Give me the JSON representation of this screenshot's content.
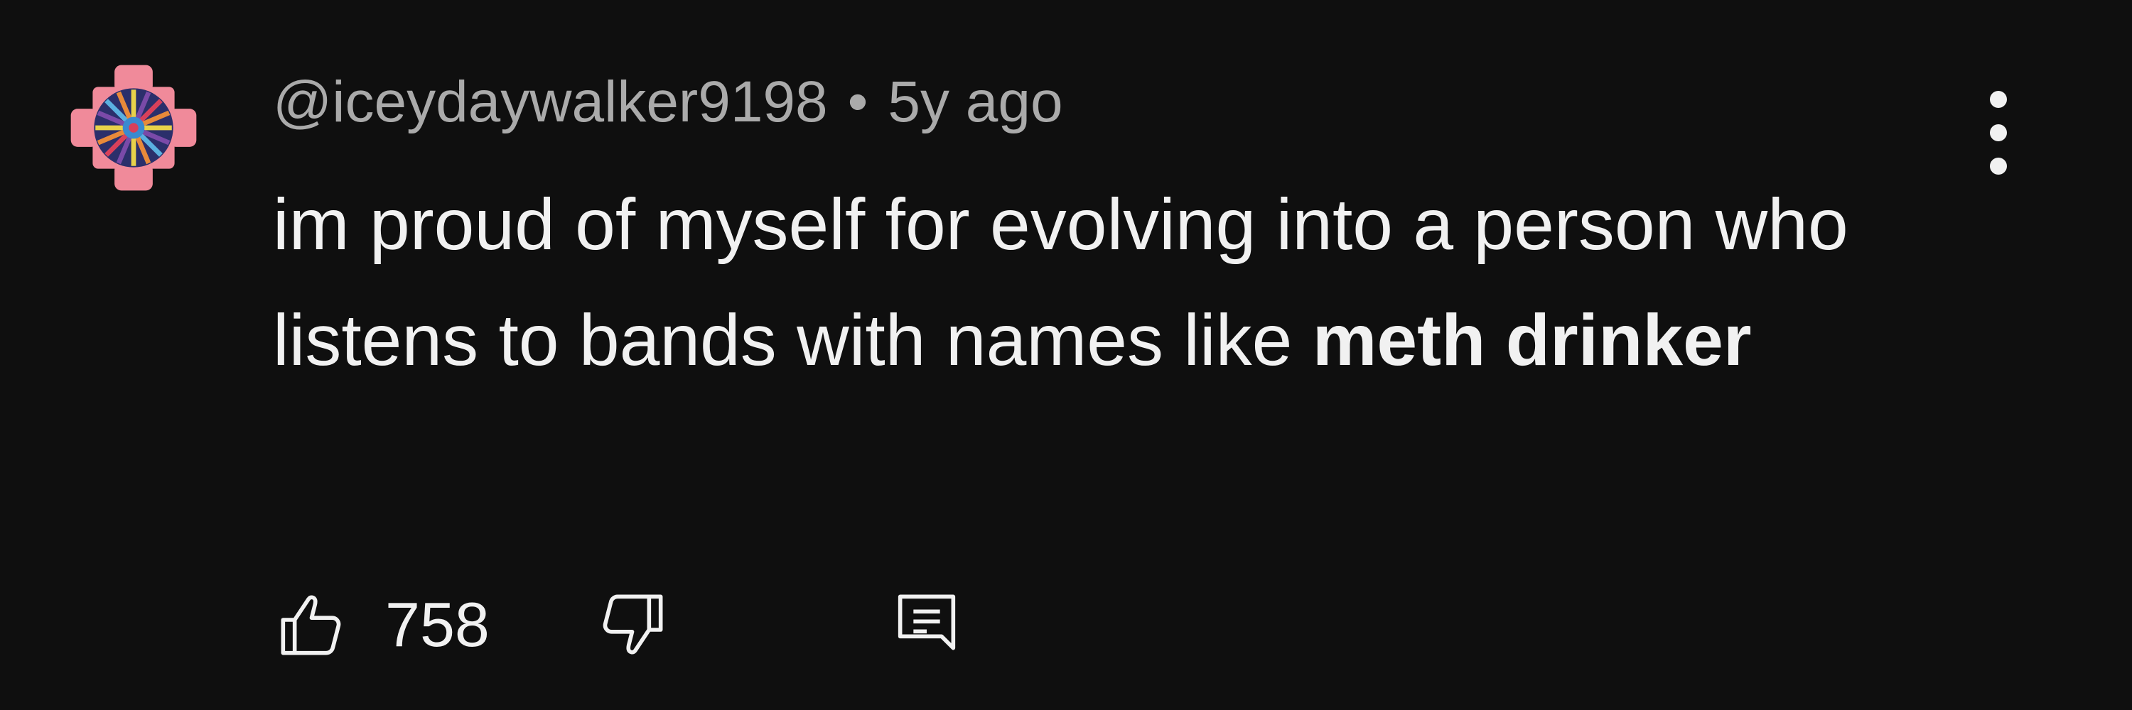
{
  "comment": {
    "author": "@iceydaywalker9198",
    "separator": "•",
    "time": "5y ago",
    "text_parts": {
      "normal": "im proud of myself for evolving into a person who listens to bands with names like ",
      "bold": "meth drinker"
    },
    "like_count": "758"
  },
  "icons": {
    "avatar": "mandala-avatar",
    "more": "vertical-ellipsis-icon",
    "like": "thumbs-up-icon",
    "dislike": "thumbs-down-icon",
    "reply": "comment-reply-icon"
  },
  "colors": {
    "background": "#0f0f0f",
    "primary_text": "#f1f1f1",
    "secondary_text": "#aaaaaa"
  }
}
